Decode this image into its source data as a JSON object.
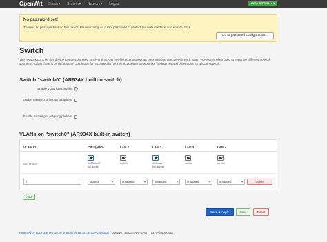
{
  "navbar": {
    "brand": "OpenWrt",
    "items": [
      {
        "label": "Status"
      },
      {
        "label": "System"
      },
      {
        "label": "Network"
      },
      {
        "label": "Logout"
      }
    ],
    "auto_refresh": "AUTO REFRESH ON"
  },
  "alert": {
    "title": "No password set!",
    "text": "There is no password set on this router. Please configure a root password to protect the web interface and enable SSH.",
    "button": "Go to password configuration..."
  },
  "page": {
    "title": "Switch",
    "description": "The network ports on this device can be combined to several VLANs in which computers can communicate directly with each other. VLANs are often used to separate different network segments. Often there is by default one Uplink port for a connection to the next greater network like the internet and other ports for a local network."
  },
  "switch_section": {
    "title": "Switch \"switch0\" (AR934X built-in switch)",
    "options": [
      {
        "label": "Enable VLAN functionality",
        "checked": true
      },
      {
        "label": "Enable mirroring of incoming packets",
        "checked": false
      },
      {
        "label": "Enable mirroring of outgoing packets",
        "checked": false
      }
    ]
  },
  "vlan_section": {
    "title": "VLANs on \"switch0\" (AR934X built-in switch)",
    "headers": [
      "VLAN ID",
      "CPU (eth0)",
      "LAN 1",
      "LAN 2",
      "LAN 3",
      "LAN 4"
    ],
    "port_status_label": "Port status:",
    "ports": [
      {
        "status": "up",
        "line1": "1000baseT",
        "line2": "full-duplex"
      },
      {
        "status": "down",
        "line1": "no link",
        "line2": ""
      },
      {
        "status": "up",
        "line1": "100baseT",
        "line2": "full-duplex"
      },
      {
        "status": "down",
        "line1": "no link",
        "line2": ""
      },
      {
        "status": "down",
        "line1": "no link",
        "line2": ""
      }
    ],
    "vlan_row": {
      "vlan_id": "1",
      "selects": [
        "tagged",
        "untagged",
        "untagged",
        "untagged",
        "untagged"
      ],
      "delete": "Delete"
    },
    "add_button": "Add"
  },
  "actions": {
    "save_apply": "Save & Apply",
    "save": "Save",
    "reset": "Reset"
  },
  "footer": {
    "link": "Powered by LuCI openwrt-18.06 branch (git-18.303.64119-b3d4bd4)",
    "text": " / OpenWrt 18.06-SNAPSHOT r7376-ffa60a0468"
  },
  "colors": {
    "navbar": "#3b3b3b",
    "auto_refresh": "#46a546",
    "alert_bg": "#fcf3c0",
    "primary": "#1f63c6",
    "positive": "#3a7f3a",
    "negative": "#b22222"
  }
}
